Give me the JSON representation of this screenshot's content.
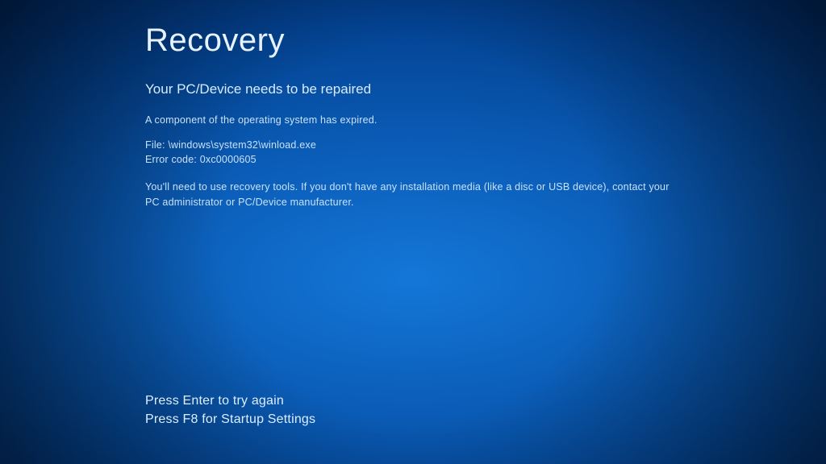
{
  "title": "Recovery",
  "subheading": "Your PC/Device needs to be repaired",
  "message": "A component of the operating system has expired.",
  "file_label": "File:",
  "file_path": "\\windows\\system32\\winload.exe",
  "error_label": "Error code:",
  "error_code": "0xc0000605",
  "instructions": "You'll need to use recovery tools. If you don't have any installation media (like a disc or USB device), contact your PC administrator or PC/Device manufacturer.",
  "options": {
    "enter": "Press Enter to try again",
    "f8": "Press F8 for Startup Settings"
  }
}
